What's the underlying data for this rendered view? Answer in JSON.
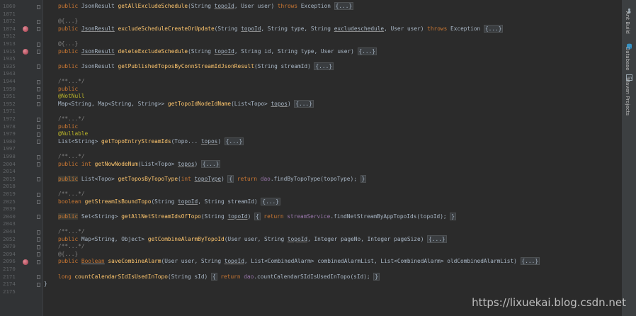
{
  "editor": {
    "lines": [
      {
        "ln": "1860",
        "segs": [
          [
            "public",
            "kw"
          ],
          [
            " JsonResult ",
            ""
          ],
          [
            "getAllExcludeSchedule",
            "fn"
          ],
          [
            "(String ",
            ""
          ],
          [
            "topoId",
            "ul"
          ],
          [
            ", User user) ",
            ""
          ],
          [
            "throws",
            "kw"
          ],
          [
            " Exception ",
            ""
          ],
          [
            "{...}",
            "ph"
          ]
        ]
      },
      {
        "ln": "1871",
        "segs": []
      },
      {
        "ln": "1872",
        "segs": [
          [
            "@{...}",
            "cm"
          ]
        ]
      },
      {
        "ln": "1874",
        "segs": [
          [
            "public",
            "kw"
          ],
          [
            " ",
            ""
          ],
          [
            "JsonResult",
            "ul"
          ],
          [
            " ",
            ""
          ],
          [
            "excludeScheduleCreateOrUpdate",
            "fn"
          ],
          [
            "(String ",
            ""
          ],
          [
            "topoId",
            "ul"
          ],
          [
            ", String type, String ",
            ""
          ],
          [
            "excludeschedule",
            "ul"
          ],
          [
            ", User user) ",
            ""
          ],
          [
            "throws",
            "kw"
          ],
          [
            " Exception ",
            ""
          ],
          [
            "{...}",
            "ph"
          ]
        ]
      },
      {
        "ln": "1912",
        "segs": []
      },
      {
        "ln": "1913",
        "segs": [
          [
            "@{...}",
            "cm"
          ]
        ]
      },
      {
        "ln": "1915",
        "segs": [
          [
            "public",
            "kw"
          ],
          [
            " ",
            ""
          ],
          [
            "JsonResult",
            "ul"
          ],
          [
            " ",
            ""
          ],
          [
            "deleteExcludeSchedule",
            "fn"
          ],
          [
            "(String ",
            ""
          ],
          [
            "topoId",
            "ul"
          ],
          [
            ", String id, String type, User user) ",
            ""
          ],
          [
            "{...}",
            "ph"
          ]
        ]
      },
      {
        "ln": "1935",
        "segs": []
      },
      {
        "ln": "1935",
        "segs": [
          [
            "public",
            "kw"
          ],
          [
            " JsonResult ",
            ""
          ],
          [
            "getPublishedToposByConnStreamIdJsonResult",
            "fn"
          ],
          [
            "(String streamId) ",
            ""
          ],
          [
            "{...}",
            "ph"
          ]
        ]
      },
      {
        "ln": "1943",
        "segs": []
      },
      {
        "ln": "1944",
        "segs": [
          [
            "/**...*/",
            "cm"
          ]
        ]
      },
      {
        "ln": "1950",
        "segs": [
          [
            "public",
            "kw"
          ]
        ]
      },
      {
        "ln": "1951",
        "segs": [
          [
            "@NotNull",
            "an"
          ]
        ]
      },
      {
        "ln": "1952",
        "segs": [
          [
            "Map<String, Map<String, String>> ",
            ""
          ],
          [
            "getTopoIdNodeIdName",
            "fn"
          ],
          [
            "(List<Topo> ",
            ""
          ],
          [
            "topos",
            "ul"
          ],
          [
            ") ",
            ""
          ],
          [
            "{...}",
            "ph"
          ]
        ]
      },
      {
        "ln": "1971",
        "segs": []
      },
      {
        "ln": "1972",
        "segs": [
          [
            "/**...*/",
            "cm"
          ]
        ]
      },
      {
        "ln": "1978",
        "segs": [
          [
            "public",
            "kw"
          ]
        ]
      },
      {
        "ln": "1979",
        "segs": [
          [
            "@Nullable",
            "an"
          ]
        ]
      },
      {
        "ln": "1980",
        "segs": [
          [
            "List<String> ",
            ""
          ],
          [
            "getTopoEntryStreamIds",
            "fn"
          ],
          [
            "(Topo... ",
            ""
          ],
          [
            "topos",
            "ul"
          ],
          [
            ") ",
            ""
          ],
          [
            "{...}",
            "ph"
          ]
        ]
      },
      {
        "ln": "1997",
        "segs": []
      },
      {
        "ln": "1998",
        "segs": [
          [
            "/**...*/",
            "cm"
          ]
        ]
      },
      {
        "ln": "2004",
        "segs": [
          [
            "public",
            "kw"
          ],
          [
            " ",
            ""
          ],
          [
            "int",
            "kw"
          ],
          [
            " ",
            ""
          ],
          [
            "getNowNodeNum",
            "fn"
          ],
          [
            "(List<Topo> ",
            ""
          ],
          [
            "topos",
            "ul"
          ],
          [
            ") ",
            ""
          ],
          [
            "{...}",
            "ph"
          ]
        ]
      },
      {
        "ln": "2014",
        "segs": []
      },
      {
        "ln": "2015",
        "segs": [
          [
            "public",
            "kw ac"
          ],
          [
            " List<Topo> ",
            ""
          ],
          [
            "getToposByTopoType",
            "fn"
          ],
          [
            "(",
            ""
          ],
          [
            "int",
            "kw"
          ],
          [
            " ",
            ""
          ],
          [
            "topoType",
            "ul"
          ],
          [
            ") ",
            ""
          ],
          [
            "{",
            "ph"
          ],
          [
            " ",
            ""
          ],
          [
            "return",
            "kw"
          ],
          [
            " ",
            ""
          ],
          [
            "dao",
            "fd"
          ],
          [
            ".findByTopoType(topoType); ",
            ""
          ],
          [
            "}",
            "ph"
          ]
        ]
      },
      {
        "ln": "2018",
        "segs": []
      },
      {
        "ln": "2019",
        "segs": [
          [
            "/**...*/",
            "cm"
          ]
        ]
      },
      {
        "ln": "2025",
        "segs": [
          [
            "boolean",
            "kw"
          ],
          [
            " ",
            ""
          ],
          [
            "getStreamIsBoundTopo",
            "fn"
          ],
          [
            "(String ",
            ""
          ],
          [
            "topoId",
            "ul"
          ],
          [
            ", String streamId) ",
            ""
          ],
          [
            "{...}",
            "ph"
          ]
        ]
      },
      {
        "ln": "2039",
        "segs": []
      },
      {
        "ln": "2040",
        "segs": [
          [
            "public",
            "kw ac"
          ],
          [
            " Set<String> ",
            ""
          ],
          [
            "getAllNetStreamIdsOfTopo",
            "fn"
          ],
          [
            "(String ",
            ""
          ],
          [
            "topoId",
            "ul"
          ],
          [
            ") ",
            ""
          ],
          [
            "{",
            "ph"
          ],
          [
            " ",
            ""
          ],
          [
            "return",
            "kw"
          ],
          [
            " ",
            ""
          ],
          [
            "streamService",
            "fd"
          ],
          [
            ".findNetStreamByAppTopoIds(topoId); ",
            ""
          ],
          [
            "}",
            "ph"
          ]
        ]
      },
      {
        "ln": "2043",
        "segs": []
      },
      {
        "ln": "2044",
        "segs": [
          [
            "/**...*/",
            "cm"
          ]
        ]
      },
      {
        "ln": "2052",
        "segs": [
          [
            "public",
            "kw"
          ],
          [
            " Map<String, Object> ",
            ""
          ],
          [
            "getCombineAlarmByTopoId",
            "fn"
          ],
          [
            "(User user, String ",
            ""
          ],
          [
            "topoId",
            "ul"
          ],
          [
            ", Integer pageNo, Integer pageSize) ",
            ""
          ],
          [
            "{...}",
            "ph"
          ]
        ]
      },
      {
        "ln": "2079",
        "segs": [
          [
            "/**...*/",
            "cm"
          ]
        ]
      },
      {
        "ln": "2094",
        "segs": [
          [
            "@{...}",
            "cm"
          ]
        ]
      },
      {
        "ln": "2096",
        "segs": [
          [
            "public",
            "kw"
          ],
          [
            " ",
            ""
          ],
          [
            "Boolean",
            "kw ul"
          ],
          [
            " ",
            ""
          ],
          [
            "saveCombineAlarm",
            "fn"
          ],
          [
            "(User user, String ",
            ""
          ],
          [
            "topoId",
            "ul"
          ],
          [
            ", List<CombinedAlarm> combinedAlarmList, List<CombinedAlarm> oldCombinedAlarmList) ",
            ""
          ],
          [
            "{...}",
            "ph"
          ]
        ]
      },
      {
        "ln": "2170",
        "segs": []
      },
      {
        "ln": "2171",
        "segs": [
          [
            "long",
            "kw"
          ],
          [
            " ",
            ""
          ],
          [
            "countCalendarSIdIsUsedInTopo",
            "fn"
          ],
          [
            "(String sId) ",
            ""
          ],
          [
            "{",
            "ph"
          ],
          [
            " ",
            ""
          ],
          [
            "return",
            "kw"
          ],
          [
            " ",
            ""
          ],
          [
            "dao",
            "fd"
          ],
          [
            ".countCalendarSIdIsUsedInTopo(sId); ",
            ""
          ],
          [
            "}",
            "ph"
          ]
        ]
      },
      {
        "ln": "2174",
        "segs": [
          [
            "}",
            ""
          ]
        ]
      },
      {
        "ln": "2175",
        "segs": []
      }
    ]
  },
  "sidebar": {
    "tabs": [
      {
        "label": "Ant Build",
        "icon": "ant-icon"
      },
      {
        "label": "Database",
        "icon": "database-icon"
      },
      {
        "label": "Maven Projects",
        "icon": "maven-icon"
      }
    ]
  },
  "watermark": "https://lixuekai.blog.csdn.net",
  "colors": {
    "background": "#2b2b2b",
    "gutter": "#313335",
    "keyword": "#cc7832",
    "method": "#ffc66d",
    "annotation": "#bbb529",
    "comment": "#808080",
    "field": "#9876aa",
    "text": "#a9b7c6",
    "line_number": "#606366"
  }
}
